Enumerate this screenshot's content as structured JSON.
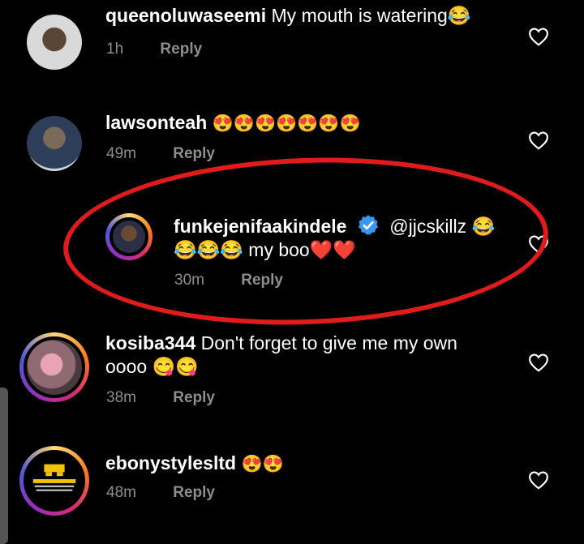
{
  "comments": [
    {
      "username": "queenoluwaseemi",
      "text": "My mouth is watering😂",
      "time": "1h",
      "reply": "Reply"
    },
    {
      "username": "lawsonteah",
      "text": "😍😍😍😍😍😍😍",
      "time": "49m",
      "reply": "Reply"
    },
    {
      "username": "funkejenifaakindele",
      "text_line1": "@jjcskillz 😂",
      "text_line2": "😂😂😂 my boo❤️❤️",
      "time": "30m",
      "reply": "Reply"
    },
    {
      "username": "kosiba344",
      "text_line1": "Don't forget to give me my own",
      "text_line2": "oooo 😋😋",
      "time": "38m",
      "reply": "Reply"
    },
    {
      "username": "ebonystylesltd",
      "text": "😍😍",
      "time": "48m",
      "reply": "Reply"
    }
  ],
  "colors": {
    "accent_ring": "#e01b1b",
    "verified": "#3897f0",
    "meta": "#8e8e8e"
  },
  "icons": {
    "like": "heart-outline-icon",
    "verified": "verified-badge-icon"
  }
}
